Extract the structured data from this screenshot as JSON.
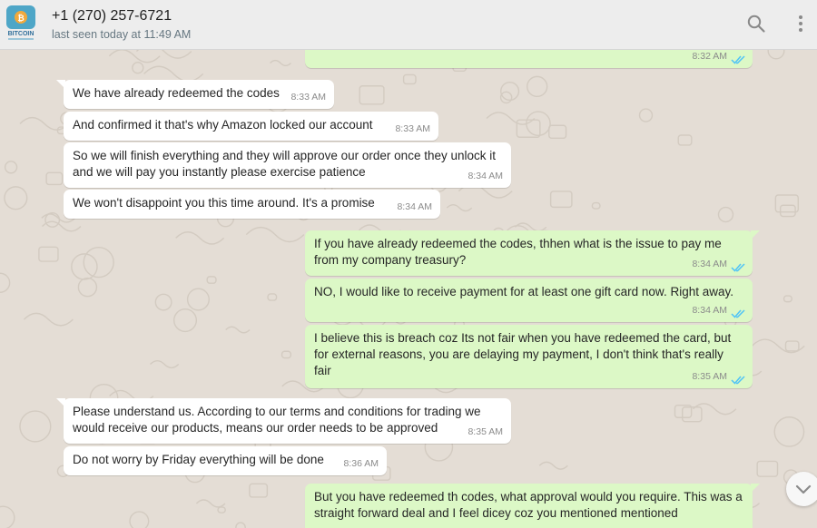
{
  "header": {
    "avatar_text": "BITCOIN",
    "contact_name": "+1 (270) 257-6721",
    "last_seen": "last seen today at 11:49 AM"
  },
  "colors": {
    "incoming_bubble": "#ffffff",
    "outgoing_bubble": "#dcf8c6",
    "read_ticks": "#4fc3f7",
    "chat_background": "#e4ddd5",
    "avatar_accent": "#4ea6c7"
  },
  "icons": {
    "search": "search-icon",
    "menu": "menu-dots-icon",
    "scroll": "chevron-down-icon",
    "read": "double-check-icon"
  },
  "messages": [
    {
      "dir": "out",
      "text": "",
      "time": "8:32 AM",
      "read": true
    },
    {
      "dir": "in",
      "text": "We have already redeemed the codes",
      "time": "8:33 AM"
    },
    {
      "dir": "in",
      "text": "And confirmed it that's why Amazon locked our account",
      "time": "8:33 AM"
    },
    {
      "dir": "in",
      "text": "So we will finish everything and they will approve our order once they unlock it and we will pay you instantly please exercise patience",
      "time": "8:34 AM"
    },
    {
      "dir": "in",
      "text": "We won't disappoint you this time around. It's a promise",
      "time": "8:34 AM"
    },
    {
      "dir": "out",
      "text": "If you have already redeemed the codes, thhen what is the issue to pay me from my company treasury?",
      "time": "8:34 AM",
      "read": true
    },
    {
      "dir": "out",
      "text": "NO, I would like to receive payment for at least one gift card now. Right away.",
      "time": "8:34 AM",
      "read": true
    },
    {
      "dir": "out",
      "text": "I believe this is breach coz Its not fair when you have redeemed the card, but for external reasons, you are delaying my payment, I don't think that's really fair",
      "time": "8:35 AM",
      "read": true
    },
    {
      "dir": "in",
      "text": "Please understand us. According to our terms and conditions for trading we would receive our products, means our order needs to be approved",
      "time": "8:35 AM"
    },
    {
      "dir": "in",
      "text": "Do not worry by Friday everything will be done",
      "time": "8:36 AM"
    },
    {
      "dir": "out",
      "text": "But you have redeemed th codes, what approval would you require. This was a straight forward deal and I feel dicey coz you mentioned mentioned",
      "time": "",
      "read": false
    }
  ]
}
